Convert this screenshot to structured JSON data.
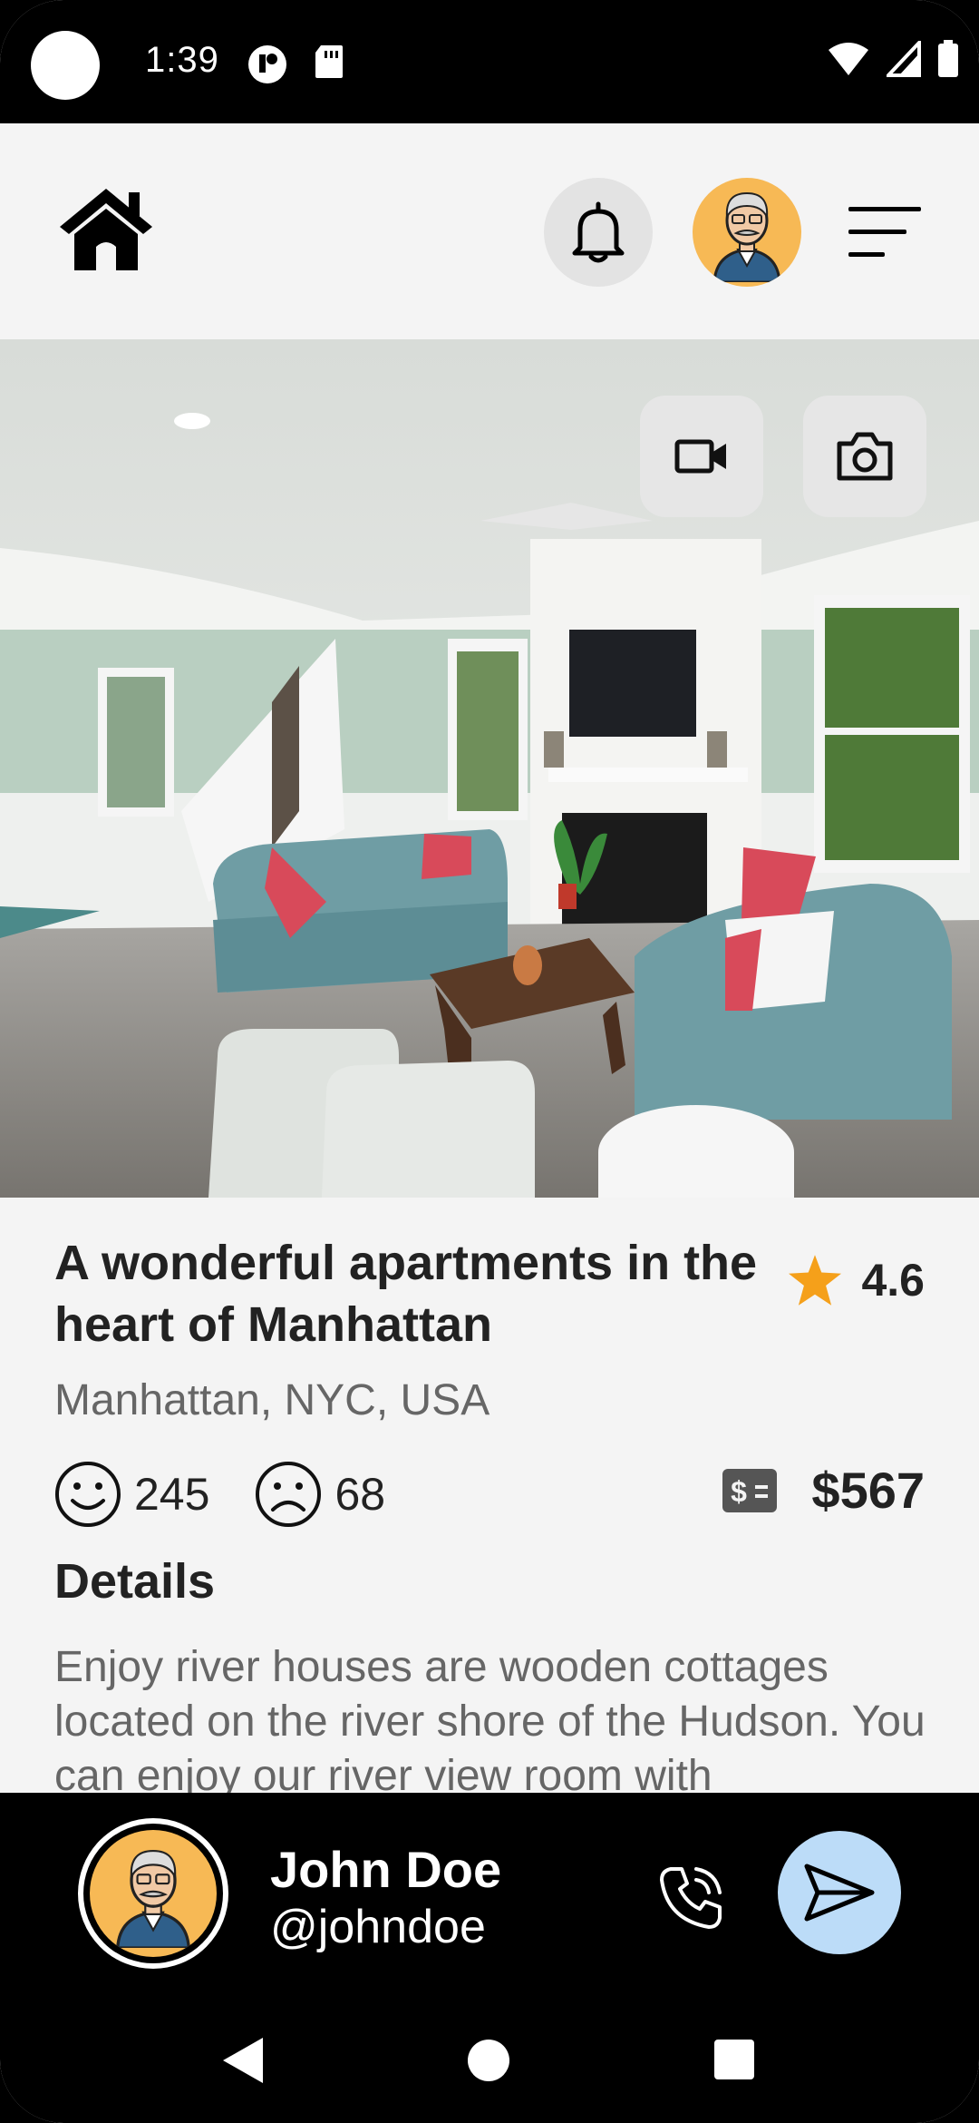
{
  "status_bar": {
    "time": "1:39",
    "icons": [
      "camera-cutout",
      "notification-app-icon",
      "sd-card-icon",
      "wifi-icon",
      "signal-icon",
      "battery-icon"
    ]
  },
  "header": {
    "icons": [
      "home-icon",
      "bell-icon",
      "user-avatar",
      "menu-icon"
    ]
  },
  "hero": {
    "image_description_icons": [
      "video-icon",
      "camera-icon"
    ]
  },
  "listing": {
    "title": "A wonderful apartments in the heart of Manhattan",
    "rating": "4.6",
    "location": "Manhattan, NYC, USA",
    "likes": "245",
    "dislikes": "68",
    "price": "$567",
    "details_heading": "Details",
    "details_text": "Enjoy river houses are wooden cottages located on the river shore of the Hudson. You can enjoy our river view room with"
  },
  "contact": {
    "name": "John Doe",
    "handle": "@johndoe"
  },
  "colors": {
    "background": "#f4f4f4",
    "bar": "#000000",
    "star": "#f5a01a",
    "avatar_bg": "#f7b955",
    "send_bg": "#bcdcf8"
  }
}
